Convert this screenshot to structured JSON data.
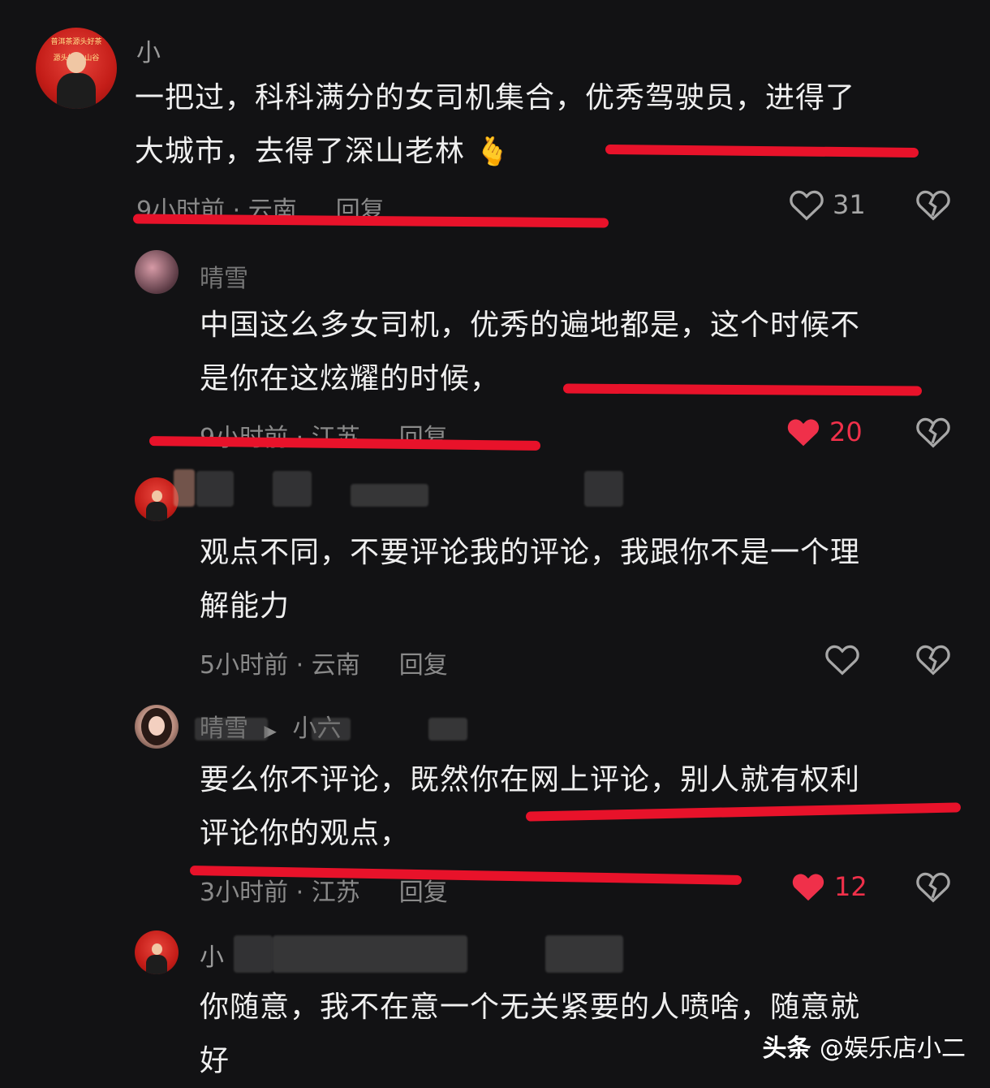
{
  "comments": [
    {
      "name": "小",
      "text_line1": "一把过，科科满分的女司机集合，优秀驾驶员，进得了",
      "text_line2": "大城市，去得了深山老林",
      "emoji": "🫰",
      "time_location": "9小时前 · 云南",
      "reply_label": "回复",
      "likes": "31",
      "liked": false,
      "avatar_sign_1": "普洱茶源头好茶",
      "avatar_sign_2": "源头好茶 山谷"
    },
    {
      "name": "晴雪",
      "text_line1": "中国这么多女司机，优秀的遍地都是，这个时候不",
      "text_line2": "是你在这炫耀的时候，",
      "time_location": "9小时前 · 江苏",
      "reply_label": "回复",
      "likes": "20",
      "liked": true
    },
    {
      "name": "",
      "text_line1": "观点不同，不要评论我的评论，我跟你不是一个理",
      "text_line2": "解能力",
      "time_location": "5小时前 · 云南",
      "reply_label": "回复",
      "likes": "",
      "liked": false
    },
    {
      "name": "晴雪",
      "reply_arrow": "▶",
      "reply_to": "小六",
      "text_line1": "要么你不评论，既然你在网上评论，别人就有权利",
      "text_line2": "评论你的观点，",
      "time_location": "3小时前 · 江苏",
      "reply_label": "回复",
      "likes": "12",
      "liked": true
    },
    {
      "name": "小",
      "text_line1": "你随意，我不在意一个无关紧要的人喷啥，随意就",
      "text_line2": "好"
    }
  ],
  "watermark": {
    "brand": "头条",
    "handle": "@娱乐店小二"
  },
  "colors": {
    "background": "#121214",
    "accent_red": "#e8122a",
    "liked_heart": "#f0304a"
  }
}
